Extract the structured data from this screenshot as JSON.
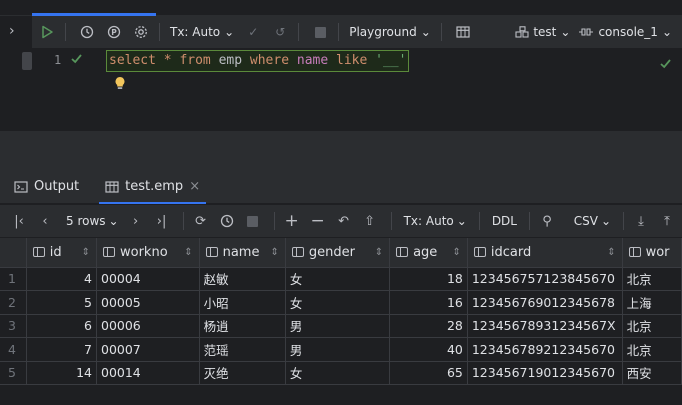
{
  "editor_toolbar": {
    "tx_mode": "Tx: Auto",
    "playground": "Playground",
    "datasource": "test",
    "console": "console_1"
  },
  "editor": {
    "line_number": "1",
    "code_tokens": [
      {
        "t": "select",
        "c": "kw"
      },
      {
        "t": " ",
        "c": "id"
      },
      {
        "t": "*",
        "c": "kw"
      },
      {
        "t": " ",
        "c": "id"
      },
      {
        "t": "from",
        "c": "kw"
      },
      {
        "t": " emp ",
        "c": "id"
      },
      {
        "t": "where",
        "c": "kw"
      },
      {
        "t": " ",
        "c": "id"
      },
      {
        "t": "name",
        "c": "kw2"
      },
      {
        "t": " ",
        "c": "id"
      },
      {
        "t": "like",
        "c": "kw"
      },
      {
        "t": " ",
        "c": "id"
      },
      {
        "t": "'__'",
        "c": "str"
      }
    ]
  },
  "service_tabs": {
    "output": "Output",
    "result": "test.emp"
  },
  "result_toolbar": {
    "rows": "5 rows",
    "tx_mode": "Tx: Auto",
    "ddl": "DDL",
    "export_format": "CSV"
  },
  "table": {
    "columns": [
      "id",
      "workno",
      "name",
      "gender",
      "age",
      "idcard",
      "wor"
    ],
    "rows": [
      [
        "1",
        "4",
        "00004",
        "赵敏",
        "女",
        "18",
        "123456757123845670",
        "北京"
      ],
      [
        "2",
        "5",
        "00005",
        "小昭",
        "女",
        "16",
        "123456769012345678",
        "上海"
      ],
      [
        "3",
        "6",
        "00006",
        "杨逍",
        "男",
        "28",
        "12345678931234567X",
        "北京"
      ],
      [
        "4",
        "7",
        "00007",
        "范瑶",
        "男",
        "40",
        "123456789212345670",
        "北京"
      ],
      [
        "5",
        "14",
        "00014",
        "灭绝",
        "女",
        "65",
        "123456719012345670",
        "西安"
      ]
    ]
  },
  "colors": {
    "accent": "#3574f0",
    "run_green": "#57965c",
    "keyword": "#cf8e6d",
    "string": "#6aab73"
  }
}
